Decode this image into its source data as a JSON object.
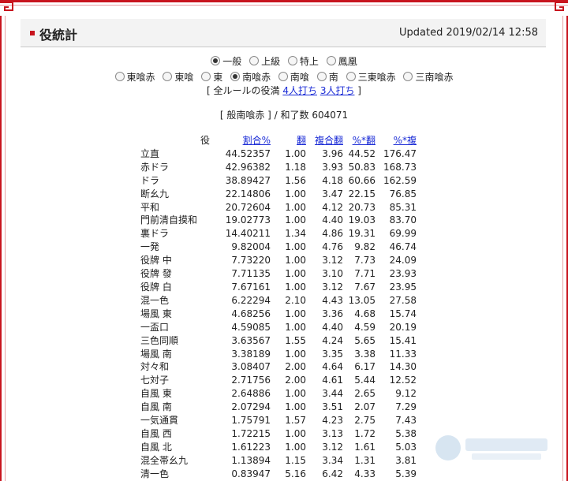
{
  "header": {
    "title": "役統計",
    "updated": "Updated 2019/02/14 12:58"
  },
  "rules": {
    "row1": [
      {
        "label": "一般",
        "selected": true
      },
      {
        "label": "上級",
        "selected": false
      },
      {
        "label": "特上",
        "selected": false
      },
      {
        "label": "鳳凰",
        "selected": false
      }
    ],
    "row2": [
      {
        "label": "東喰赤",
        "selected": false
      },
      {
        "label": "東喰",
        "selected": false
      },
      {
        "label": "東",
        "selected": false
      },
      {
        "label": "南喰赤",
        "selected": true
      },
      {
        "label": "南喰",
        "selected": false
      },
      {
        "label": "南",
        "selected": false
      },
      {
        "label": "三東喰赤",
        "selected": false
      },
      {
        "label": "三南喰赤",
        "selected": false
      }
    ],
    "all_prefix": "[ 全ルールの役満 ",
    "link_4p": "4人打ち",
    "link_3p": "3人打ち",
    "all_suffix": " ]"
  },
  "summary": "[ 般南喰赤 ] / 和了数 604071",
  "table": {
    "headers": {
      "name": "役",
      "rate": "割合%",
      "han": "翻",
      "fhan": "複合翻",
      "pct": "%*翻",
      "fpct": "%*複"
    },
    "rows": [
      [
        "立直",
        "44.52357",
        "1.00",
        "3.96",
        "44.52",
        "176.47"
      ],
      [
        "赤ドラ",
        "42.96382",
        "1.18",
        "3.93",
        "50.83",
        "168.73"
      ],
      [
        "ドラ",
        "38.89427",
        "1.56",
        "4.18",
        "60.66",
        "162.59"
      ],
      [
        "断幺九",
        "22.14806",
        "1.00",
        "3.47",
        "22.15",
        "76.85"
      ],
      [
        "平和",
        "20.72604",
        "1.00",
        "4.12",
        "20.73",
        "85.31"
      ],
      [
        "門前清自摸和",
        "19.02773",
        "1.00",
        "4.40",
        "19.03",
        "83.70"
      ],
      [
        "裏ドラ",
        "14.40211",
        "1.34",
        "4.86",
        "19.31",
        "69.99"
      ],
      [
        "一発",
        "9.82004",
        "1.00",
        "4.76",
        "9.82",
        "46.74"
      ],
      [
        "役牌 中",
        "7.73220",
        "1.00",
        "3.12",
        "7.73",
        "24.09"
      ],
      [
        "役牌 發",
        "7.71135",
        "1.00",
        "3.10",
        "7.71",
        "23.93"
      ],
      [
        "役牌 白",
        "7.67161",
        "1.00",
        "3.12",
        "7.67",
        "23.95"
      ],
      [
        "混一色",
        "6.22294",
        "2.10",
        "4.43",
        "13.05",
        "27.58"
      ],
      [
        "場風 東",
        "4.68256",
        "1.00",
        "3.36",
        "4.68",
        "15.74"
      ],
      [
        "一盃口",
        "4.59085",
        "1.00",
        "4.40",
        "4.59",
        "20.19"
      ],
      [
        "三色同順",
        "3.63567",
        "1.55",
        "4.24",
        "5.65",
        "15.41"
      ],
      [
        "場風 南",
        "3.38189",
        "1.00",
        "3.35",
        "3.38",
        "11.33"
      ],
      [
        "対々和",
        "3.08407",
        "2.00",
        "4.64",
        "6.17",
        "14.30"
      ],
      [
        "七対子",
        "2.71756",
        "2.00",
        "4.61",
        "5.44",
        "12.52"
      ],
      [
        "自風 東",
        "2.64886",
        "1.00",
        "3.44",
        "2.65",
        "9.12"
      ],
      [
        "自風 南",
        "2.07294",
        "1.00",
        "3.51",
        "2.07",
        "7.29"
      ],
      [
        "一気通貫",
        "1.75791",
        "1.57",
        "4.23",
        "2.75",
        "7.43"
      ],
      [
        "自風 西",
        "1.72215",
        "1.00",
        "3.13",
        "1.72",
        "5.38"
      ],
      [
        "自風 北",
        "1.61223",
        "1.00",
        "3.12",
        "1.61",
        "5.03"
      ],
      [
        "混全帯幺九",
        "1.13894",
        "1.15",
        "3.34",
        "1.31",
        "3.81"
      ],
      [
        "清一色",
        "0.83947",
        "5.16",
        "6.42",
        "4.33",
        "5.39"
      ]
    ]
  },
  "colors": {
    "frame_red": "#c8141e",
    "link_blue": "#1a2bd6"
  }
}
